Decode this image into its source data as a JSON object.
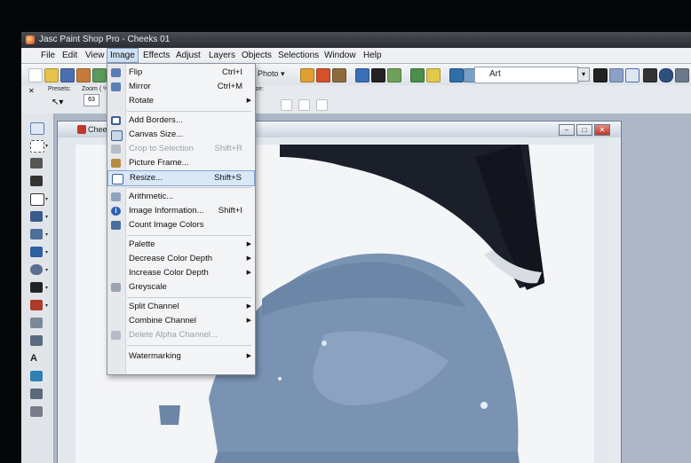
{
  "app": {
    "title": "Jasc Paint Shop Pro - Cheeks 01"
  },
  "menubar": {
    "items": [
      "File",
      "Edit",
      "View",
      "Image",
      "Effects",
      "Adjust",
      "Layers",
      "Objects",
      "Selections",
      "Window",
      "Help"
    ],
    "active": "Image"
  },
  "toolbar": {
    "photo_label": "Photo ▾",
    "art_label": "Art"
  },
  "tool_options": {
    "presets_label": "Presets:",
    "zoom_label": "Zoom ( %",
    "zoom_value": "63",
    "size_label": "ize:"
  },
  "document": {
    "title": "Chee"
  },
  "image_menu": {
    "items": [
      {
        "label": "Flip",
        "shortcut": "Ctrl+I",
        "icon": "flip-icon",
        "submenu": false,
        "disabled": false
      },
      {
        "label": "Mirror",
        "shortcut": "Ctrl+M",
        "icon": "mirror-icon",
        "submenu": false,
        "disabled": false
      },
      {
        "label": "Rotate",
        "shortcut": "",
        "icon": "",
        "submenu": true,
        "disabled": false
      },
      {
        "label": "Add Borders...",
        "shortcut": "",
        "icon": "add-borders-icon",
        "submenu": false,
        "disabled": false
      },
      {
        "label": "Canvas Size...",
        "shortcut": "",
        "icon": "canvas-size-icon",
        "submenu": false,
        "disabled": false
      },
      {
        "label": "Crop to Selection",
        "shortcut": "Shift+R",
        "icon": "crop-icon",
        "submenu": false,
        "disabled": true
      },
      {
        "label": "Picture Frame...",
        "shortcut": "",
        "icon": "picture-frame-icon",
        "submenu": false,
        "disabled": false
      },
      {
        "label": "Resize...",
        "shortcut": "Shift+S",
        "icon": "resize-icon",
        "submenu": false,
        "disabled": false,
        "hover": true
      },
      {
        "label": "Arithmetic...",
        "shortcut": "",
        "icon": "arithmetic-icon",
        "submenu": false,
        "disabled": false
      },
      {
        "label": "Image Information...",
        "shortcut": "Shift+I",
        "icon": "info-icon",
        "submenu": false,
        "disabled": false
      },
      {
        "label": "Count Image Colors",
        "shortcut": "",
        "icon": "count-colors-icon",
        "submenu": false,
        "disabled": false
      },
      {
        "label": "Palette",
        "shortcut": "",
        "icon": "",
        "submenu": true,
        "disabled": false
      },
      {
        "label": "Decrease Color Depth",
        "shortcut": "",
        "icon": "",
        "submenu": true,
        "disabled": false
      },
      {
        "label": "Increase Color Depth",
        "shortcut": "",
        "icon": "",
        "submenu": true,
        "disabled": false
      },
      {
        "label": "Greyscale",
        "shortcut": "",
        "icon": "greyscale-icon",
        "submenu": false,
        "disabled": false
      },
      {
        "label": "Split Channel",
        "shortcut": "",
        "icon": "",
        "submenu": true,
        "disabled": false
      },
      {
        "label": "Combine Channel",
        "shortcut": "",
        "icon": "",
        "submenu": true,
        "disabled": false
      },
      {
        "label": "Delete Alpha Channel...",
        "shortcut": "",
        "icon": "delete-alpha-icon",
        "submenu": false,
        "disabled": true
      },
      {
        "label": "Watermarking",
        "shortcut": "",
        "icon": "",
        "submenu": true,
        "disabled": false
      }
    ]
  },
  "colors": {
    "accent": "#82a7d4",
    "canvas_dark": "#1b1f2a",
    "canvas_blue": "#7a93b3",
    "canvas_white": "#f4f5f7"
  }
}
